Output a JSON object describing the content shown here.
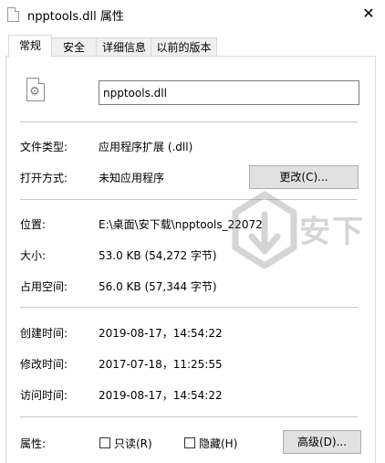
{
  "window": {
    "title": "npptools.dll 属性",
    "close_glyph": "✕"
  },
  "tabs": [
    {
      "label": "常规",
      "active": true
    },
    {
      "label": "安全",
      "active": false
    },
    {
      "label": "详细信息",
      "active": false
    },
    {
      "label": "以前的版本",
      "active": false
    }
  ],
  "file": {
    "name": "npptools.dll",
    "icon": "dll-gear-icon"
  },
  "type_section": {
    "file_type_label": "文件类型:",
    "file_type_value": "应用程序扩展 (.dll)",
    "open_with_label": "打开方式:",
    "open_with_value": "未知应用程序",
    "change_button": "更改(C)..."
  },
  "location_section": {
    "location_label": "位置:",
    "location_value": "E:\\桌面\\安下载\\npptools_22072",
    "size_label": "大小:",
    "size_value": "53.0 KB (54,272 字节)",
    "size_on_disk_label": "占用空间:",
    "size_on_disk_value": "56.0 KB (57,344 字节)"
  },
  "time_section": {
    "created_label": "创建时间:",
    "created_value": "2019-08-17，14:54:22",
    "modified_label": "修改时间:",
    "modified_value": "2017-07-18，11:25:55",
    "accessed_label": "访问时间:",
    "accessed_value": "2019-08-17，14:54:22"
  },
  "attributes": {
    "label": "属性:",
    "readonly_label": "只读(R)",
    "readonly_checked": false,
    "hidden_label": "隐藏(H)",
    "hidden_checked": false,
    "advanced_button": "高级(D)..."
  },
  "colors": {
    "background": "#ffffff",
    "border": "#d9d9d9",
    "button_face": "#e1e1e1",
    "divider": "#c8c8c8"
  }
}
